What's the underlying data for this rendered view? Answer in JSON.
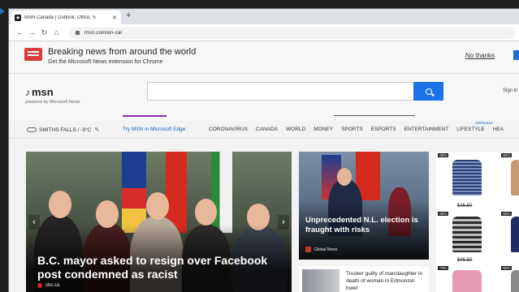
{
  "browser": {
    "tab_title": "MSN Canada | Outlook, Office, S",
    "tab_favicon": "msn-favicon",
    "url": "msn.com/en-ca/"
  },
  "promo": {
    "title": "Breaking news from around the world",
    "subtitle": "Get the Microsoft News extension for Chrome",
    "dismiss": "No thanks",
    "accent": "#d93b3b"
  },
  "header": {
    "logo": "msn",
    "logo_sub": "powered by Microsoft News",
    "search_placeholder": "",
    "signin": "Sign in",
    "search_color": "#1a73e8"
  },
  "navbar": {
    "weather": "SMITHS FALLS / -9°C",
    "try_edge": "Try MSN in Microsoft Edge",
    "items": [
      "CORONAVIRUS",
      "CANADA",
      "WORLD",
      "MONEY",
      "SPORTS",
      "ESPORTS",
      "ENTERTAINMENT",
      "LIFESTYLE",
      "HEA"
    ],
    "adchoices": "AdChoices"
  },
  "hero": {
    "title": "B.C. mayor asked to resign over Facebook post condemned as racist",
    "source": "cbc.ca"
  },
  "story2": {
    "title": "Unprecedented N.L. election is fraught with risks",
    "source": "Global News"
  },
  "story3": {
    "title": "Trucker guilty of manslaughter in death of woman in Edmonton hotel"
  },
  "ad": {
    "badges": [
      "-65%",
      "-65%",
      "-65%",
      "-60%",
      "-70%",
      "-60%"
    ],
    "prices": [
      "$46.50",
      "$46.50"
    ]
  }
}
